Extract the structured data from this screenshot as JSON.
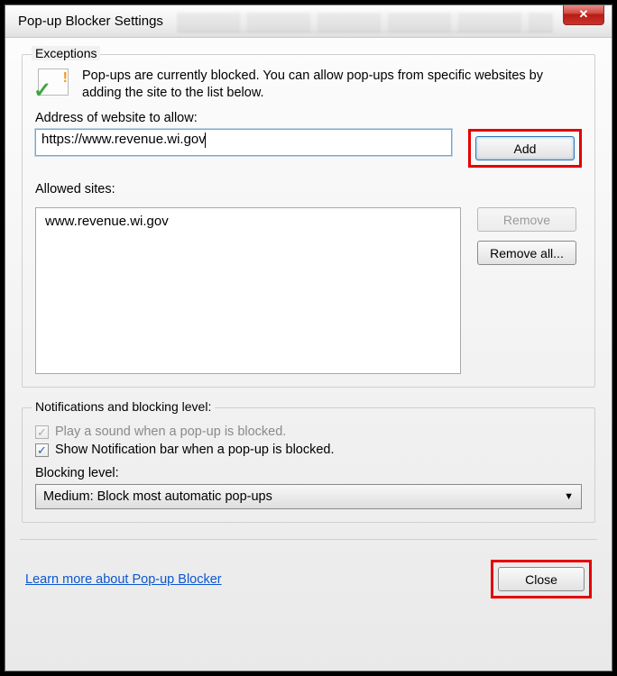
{
  "window": {
    "title": "Pop-up Blocker Settings"
  },
  "exceptions": {
    "legend": "Exceptions",
    "description": "Pop-ups are currently blocked.  You can allow pop-ups from specific websites by adding the site to the list below.",
    "address_label": "Address of website to allow:",
    "address_value": "https://www.revenue.wi.gov",
    "add_button": "Add",
    "allowed_label": "Allowed sites:",
    "allowed_sites": [
      "www.revenue.wi.gov"
    ],
    "remove_button": "Remove",
    "remove_all_button": "Remove all..."
  },
  "notifications": {
    "legend": "Notifications and blocking level:",
    "play_sound_label": "Play a sound when a pop-up is blocked.",
    "play_sound_checked": true,
    "play_sound_enabled": false,
    "show_bar_label": "Show Notification bar when a pop-up is blocked.",
    "show_bar_checked": true,
    "blocking_level_label": "Blocking level:",
    "blocking_level_value": "Medium: Block most automatic pop-ups"
  },
  "footer": {
    "link_text": "Learn more about Pop-up Blocker",
    "close_button": "Close"
  }
}
